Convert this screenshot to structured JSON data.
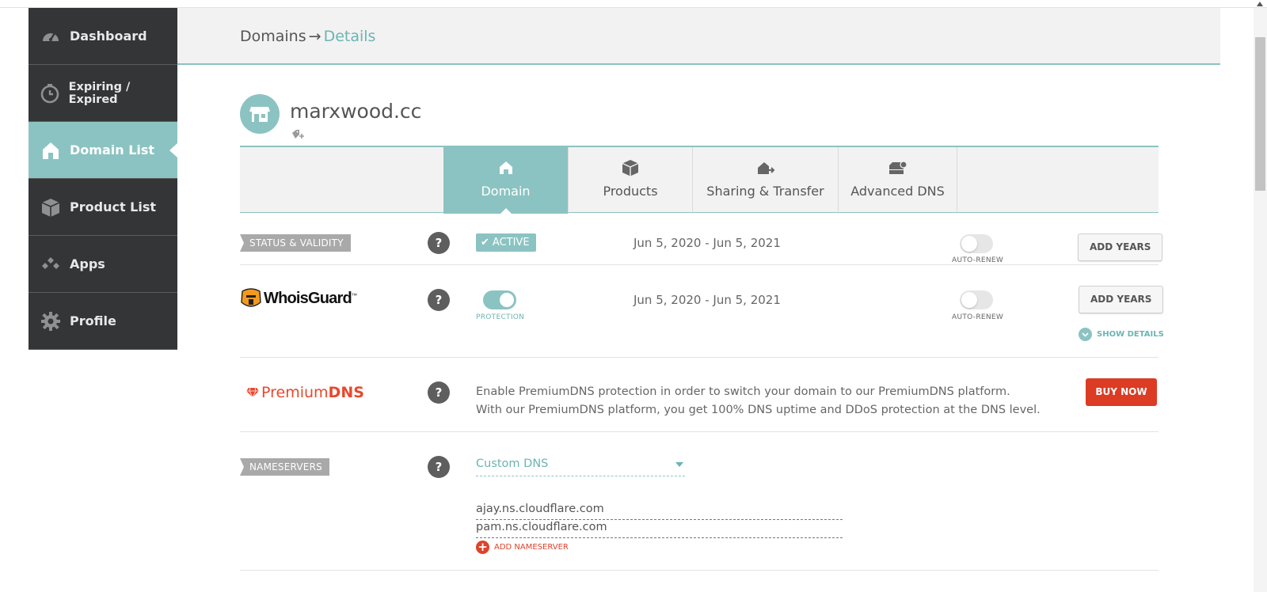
{
  "sidebar": {
    "items": [
      {
        "label": "Dashboard",
        "icon": "gauge-icon"
      },
      {
        "label": "Expiring / Expired",
        "icon": "clock-icon"
      },
      {
        "label": "Domain List",
        "icon": "house-icon",
        "active": true
      },
      {
        "label": "Product List",
        "icon": "box-icon"
      },
      {
        "label": "Apps",
        "icon": "apps-icon"
      },
      {
        "label": "Profile",
        "icon": "gear-icon"
      }
    ]
  },
  "breadcrumb": {
    "root": "Domains",
    "separator": "→",
    "current": "Details"
  },
  "domain": {
    "name": "marxwood.cc"
  },
  "tabs": [
    {
      "label": "Domain",
      "icon": "house-icon",
      "active": true
    },
    {
      "label": "Products",
      "icon": "box-icon"
    },
    {
      "label": "Sharing & Transfer",
      "icon": "house-arrow-icon"
    },
    {
      "label": "Advanced DNS",
      "icon": "server-gear-icon"
    }
  ],
  "status": {
    "label": "STATUS & VALIDITY",
    "help": "?",
    "badge": "ACTIVE",
    "dates": "Jun 5, 2020 - Jun 5, 2021",
    "auto_renew_label": "AUTO-RENEW",
    "auto_renew_on": false,
    "add_years": "ADD YEARS"
  },
  "whoisguard": {
    "logo_text": "WhoisGuard",
    "logo_tm": "™",
    "help": "?",
    "protection_label": "PROTECTION",
    "protection_on": true,
    "dates": "Jun 5, 2020 - Jun 5, 2021",
    "auto_renew_label": "AUTO-RENEW",
    "auto_renew_on": false,
    "add_years": "ADD YEARS",
    "show_details": "SHOW DETAILS"
  },
  "premiumdns": {
    "logo_part1": "Premium",
    "logo_part2": "DNS",
    "help": "?",
    "desc_line1": "Enable PremiumDNS protection in order to switch your domain to our PremiumDNS platform.",
    "desc_line2": "With our PremiumDNS platform, you get 100% DNS uptime and DDoS protection at the DNS level.",
    "buy_now": "BUY NOW"
  },
  "nameservers": {
    "label": "NAMESERVERS",
    "help": "?",
    "selected": "Custom DNS",
    "servers": [
      "ajay.ns.cloudflare.com",
      "pam.ns.cloudflare.com"
    ],
    "add_label": "ADD NAMESERVER",
    "add_icon": "+"
  },
  "colors": {
    "accent": "#8bc3c2",
    "sidebar_bg": "#333537",
    "buy": "#dc3b24"
  }
}
